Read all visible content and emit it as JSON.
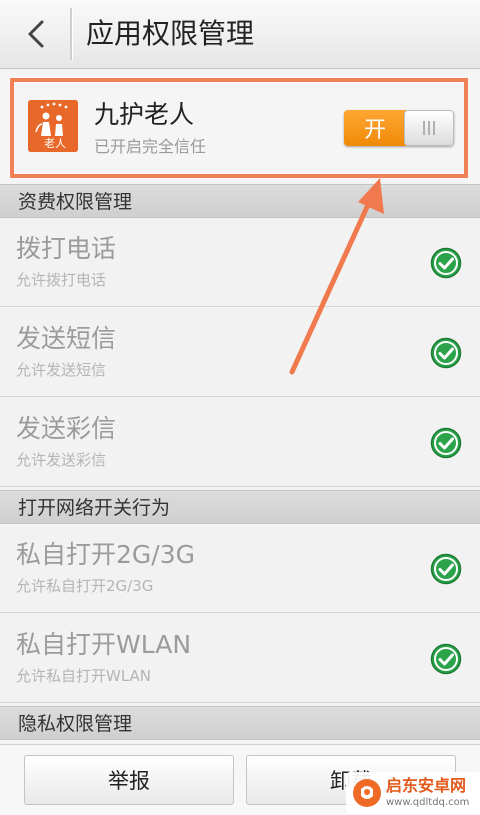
{
  "header": {
    "title": "应用权限管理",
    "back_icon": "chevron-left-icon"
  },
  "app": {
    "name": "九护老人",
    "subtitle": "已开启完全信任",
    "icon_text": "老人",
    "icon_color": "#e8682a",
    "trust_toggle": {
      "on_label": "开",
      "state": "on",
      "color": "#f08a08"
    }
  },
  "sections": [
    {
      "title": "资费权限管理",
      "items": [
        {
          "title": "拨打电话",
          "subtitle": "允许拨打电话",
          "allowed": true
        },
        {
          "title": "发送短信",
          "subtitle": "允许发送短信",
          "allowed": true
        },
        {
          "title": "发送彩信",
          "subtitle": "允许发送彩信",
          "allowed": true
        }
      ]
    },
    {
      "title": "打开网络开关行为",
      "items": [
        {
          "title": "私自打开2G/3G",
          "subtitle": "允许私自打开2G/3G",
          "allowed": true
        },
        {
          "title": "私自打开WLAN",
          "subtitle": "允许私自打开WLAN",
          "allowed": true
        }
      ]
    },
    {
      "title": "隐私权限管理",
      "items": []
    }
  ],
  "bottom": {
    "report_label": "举报",
    "uninstall_label": "卸载"
  },
  "annotation": {
    "color": "#f07a4e"
  },
  "watermark": {
    "brand": "启东安卓网",
    "url": "www.qdltdq.com"
  }
}
